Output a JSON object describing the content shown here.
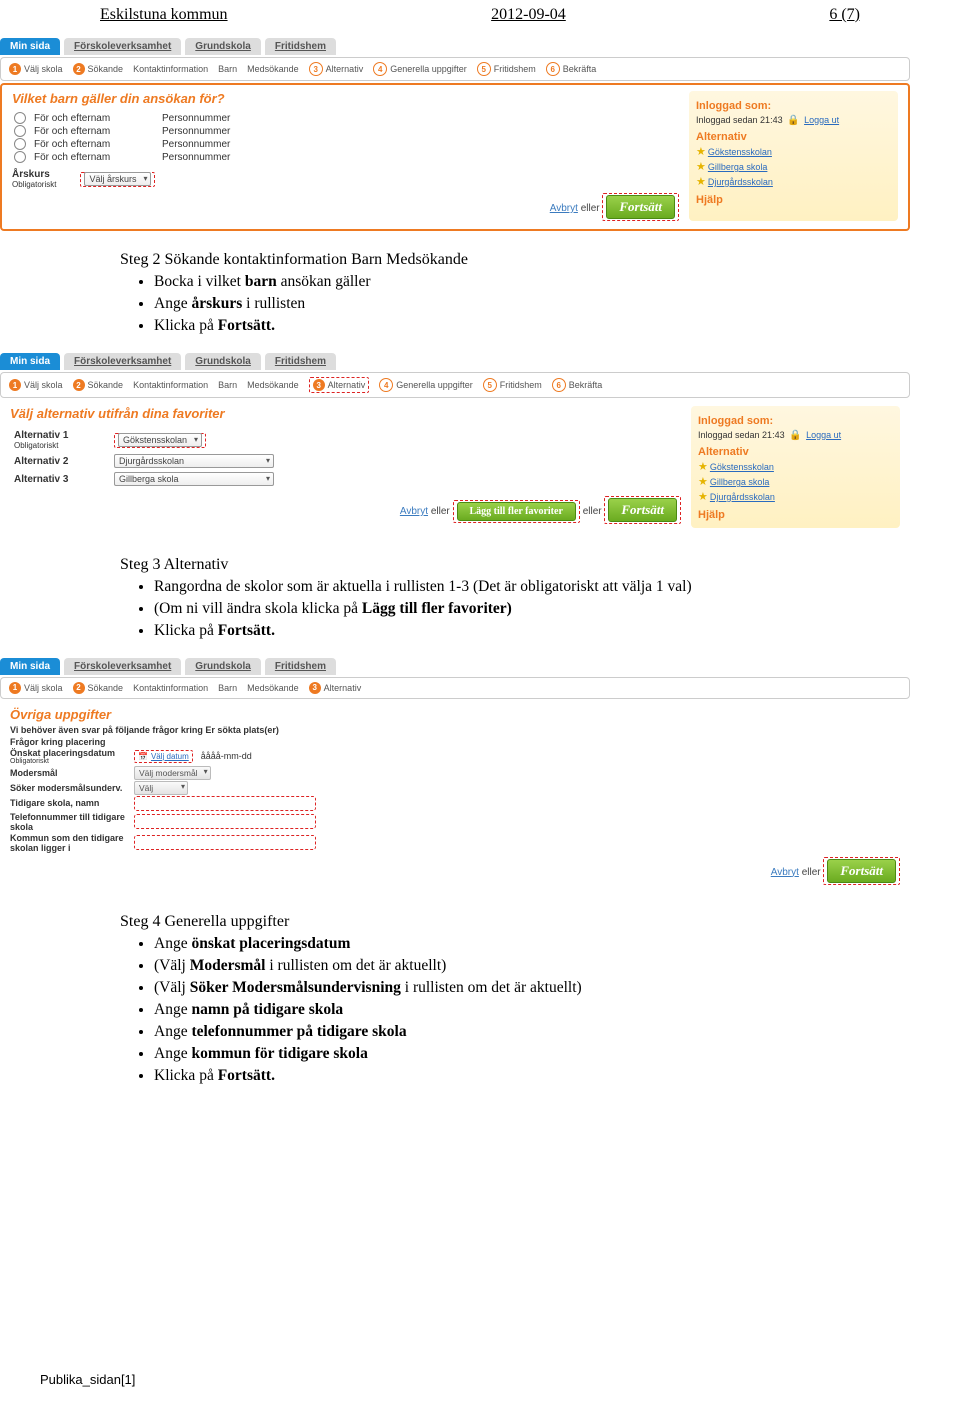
{
  "header": {
    "org": "Eskilstuna kommun",
    "date": "2012-09-04",
    "page": "6 (7)"
  },
  "tabs": [
    "Min sida",
    "Förskoleverksamhet",
    "Grundskola",
    "Fritidshem"
  ],
  "wizard": {
    "s1": "Välj skola",
    "s2": "Sökande",
    "s3": "Kontaktinformation",
    "s4": "Barn",
    "s5": "Medsökande",
    "s6": "Alternativ",
    "s7": "Generella uppgifter",
    "s8": "Fritidshem",
    "s9": "Bekräfta"
  },
  "shot1": {
    "title": "Vilket barn gäller din ansökan för?",
    "kid_name": "För och efternam",
    "kid_pnr": "Personnummer",
    "arskurs_label": "Årskurs",
    "obl": "Obligatoriskt",
    "valj_arskurs": "Välj årskurs",
    "avbryt": "Avbryt",
    "eller": "eller",
    "fortsatt": "Fortsätt"
  },
  "sidebar": {
    "inloggad_head": "Inloggad som:",
    "inloggad_time": "Inloggad sedan 21:43",
    "logga_ut": "Logga ut",
    "alt_head": "Alternativ",
    "sk1": "Gökstensskolan",
    "sk2": "Gillberga skola",
    "sk3": "Djurgårdsskolan",
    "hjalp": "Hjälp"
  },
  "step2": {
    "title": "Steg 2 Sökande kontaktinformation Barn Medsökande",
    "b1a": "Bocka i vilket ",
    "b1b": "barn",
    "b1c": " ansökan gäller",
    "b2a": "Ange ",
    "b2b": "årskurs",
    "b2c": " i rullisten",
    "b3a": "Klicka på ",
    "b3b": "Fortsätt."
  },
  "shot2": {
    "title": "Välj alternativ utifrån dina favoriter",
    "alt1": "Alternativ 1",
    "alt2": "Alternativ 2",
    "alt3": "Alternativ 3",
    "obl": "Obligatoriskt",
    "sel1": "Gökstensskolan",
    "sel2": "Djurgårdsskolan",
    "sel3": "Gillberga skola",
    "avbryt": "Avbryt",
    "eller": "eller",
    "lagg": "Lägg till fler favoriter",
    "fortsatt": "Fortsätt"
  },
  "step3": {
    "title": "Steg 3 Alternativ",
    "b1": "Rangordna de skolor som är aktuella i rullisten 1-3 (Det är obligatoriskt att välja 1 val)",
    "b2a": "(Om ni vill ändra skola klicka på ",
    "b2b": "Lägg till fler favoriter)",
    "b3a": "Klicka på ",
    "b3b": "Fortsätt."
  },
  "shot3": {
    "head": "Övriga uppgifter",
    "sub": "Vi behöver även svar på följande frågor kring Er sökta plats(er)",
    "fragor": "Frågor kring placering",
    "onskat": "Önskat placeringsdatum",
    "obl": "Obligatoriskt",
    "valj_datum": "Välj datum",
    "date_fmt": "åååå-mm-dd",
    "modersmal": "Modersmål",
    "valj_modersmal": "Välj modersmål",
    "soker": "Söker modersmålsunderv.",
    "valj": "Välj",
    "tidigare_namn": "Tidigare skola, namn",
    "tel_tidigare": "Telefonnummer till tidigare skola",
    "kommun_tidigare": "Kommun som den tidigare skolan ligger i",
    "avbryt": "Avbryt",
    "eller": "eller",
    "fortsatt": "Fortsätt"
  },
  "step4": {
    "title": "Steg 4 Generella uppgifter",
    "b1a": "Ange ",
    "b1b": "önskat placeringsdatum",
    "b2a": "(Välj ",
    "b2b": "Modersmål",
    "b2c": " i rullisten om det är aktuellt)",
    "b3a": "(Välj ",
    "b3b": "Söker Modersmålsundervisning",
    "b3c": " i rullisten om det är aktuellt)",
    "b4a": "Ange ",
    "b4b": "namn på tidigare skola",
    "b5a": "Ange ",
    "b5b": "telefonnummer på tidigare skola",
    "b6a": "Ange ",
    "b6b": "kommun för tidigare skola",
    "b7a": "Klicka på ",
    "b7b": "Fortsätt."
  },
  "footer": "Publika_sidan[1]"
}
